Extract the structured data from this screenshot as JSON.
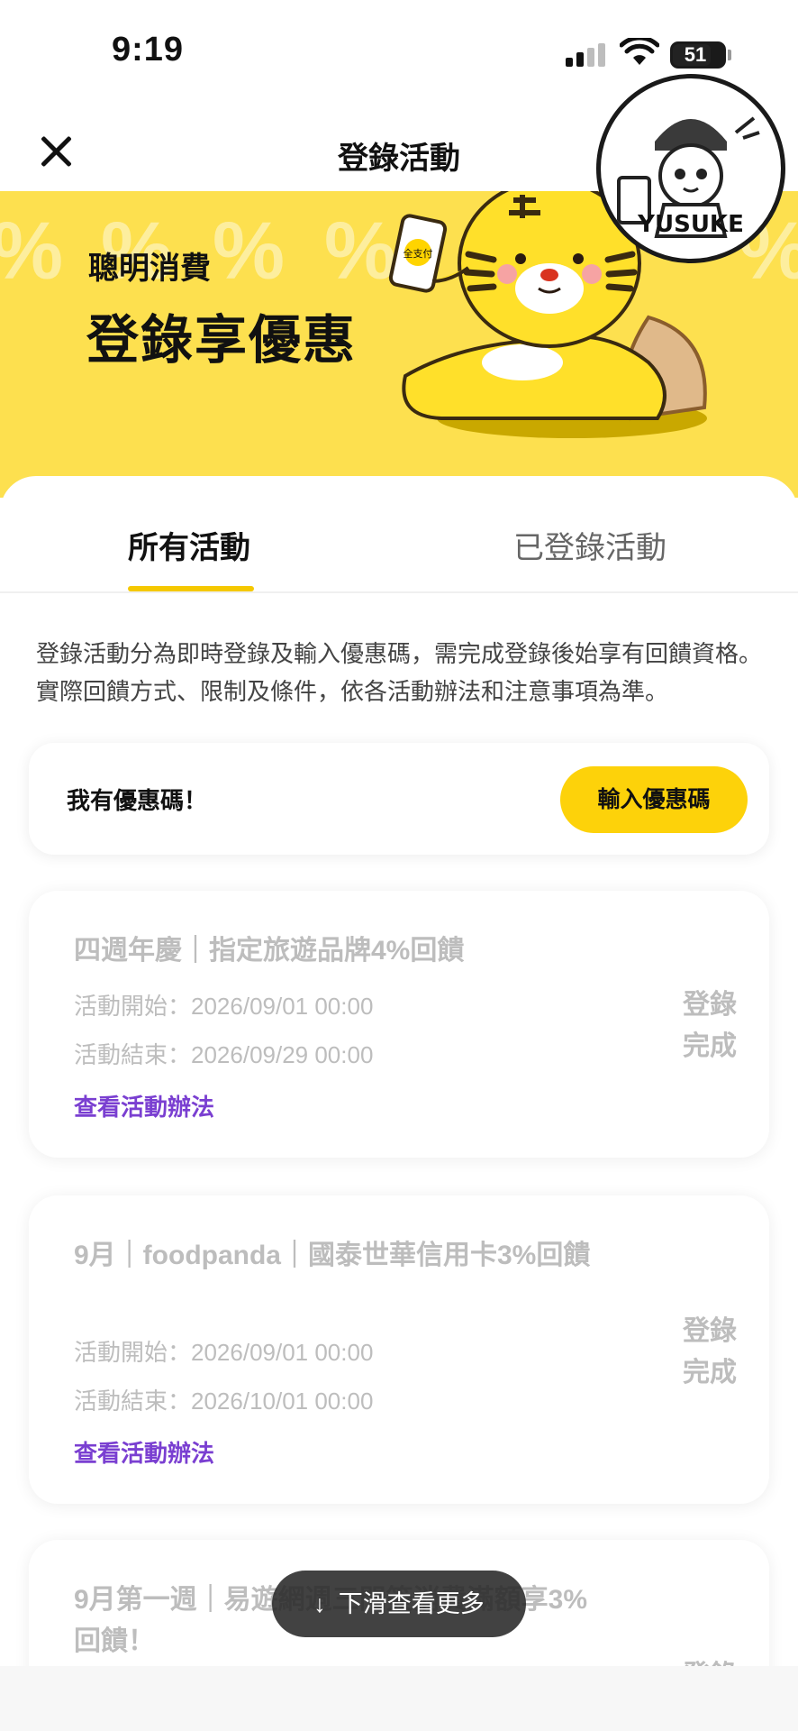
{
  "status_bar": {
    "time": "9:19",
    "battery": "51"
  },
  "header": {
    "title": "登錄活動"
  },
  "hero": {
    "subtitle": "聰明消費",
    "headline": "登錄享優惠",
    "phone_label": "全支付",
    "pattern_glyph": "%"
  },
  "stamp": {
    "text": "YUSUKE"
  },
  "tabs": [
    {
      "label": "所有活動",
      "active": true
    },
    {
      "label": "已登錄活動",
      "active": false
    }
  ],
  "intro": "登錄活動分為即時登錄及輸入優惠碼，需完成登錄後始享有回饋資格。實際回饋方式、限制及條件，依各活動辦法和注意事項為準。",
  "promo": {
    "label": "我有優惠碼！",
    "button": "輸入優惠碼"
  },
  "events": [
    {
      "title": "四週年慶｜指定旅遊品牌4%回饋",
      "start": "活動開始：2026/09/01 00:00",
      "end": "活動結束：2026/09/29 00:00",
      "link": "查看活動辦法",
      "status": "登錄完成"
    },
    {
      "title": "9月｜foodpanda｜國泰世華信用卡3%回饋",
      "start": "活動開始：2026/09/01 00:00",
      "end": "活動結束：2026/10/01 00:00",
      "link": "查看活動辦法",
      "status": "登錄完成"
    },
    {
      "title": "9月第一週｜易遊網週三門簽消費滿額享3%回饋！",
      "status": "登錄"
    }
  ],
  "scroll_hint": {
    "label": "下滑查看更多",
    "icon": "arrow-down-icon"
  },
  "colors": {
    "brand_yellow": "#fdd20a",
    "hero_bg": "#fde04f",
    "link_purple": "#7a3fd1",
    "muted": "#bdbdbd"
  }
}
